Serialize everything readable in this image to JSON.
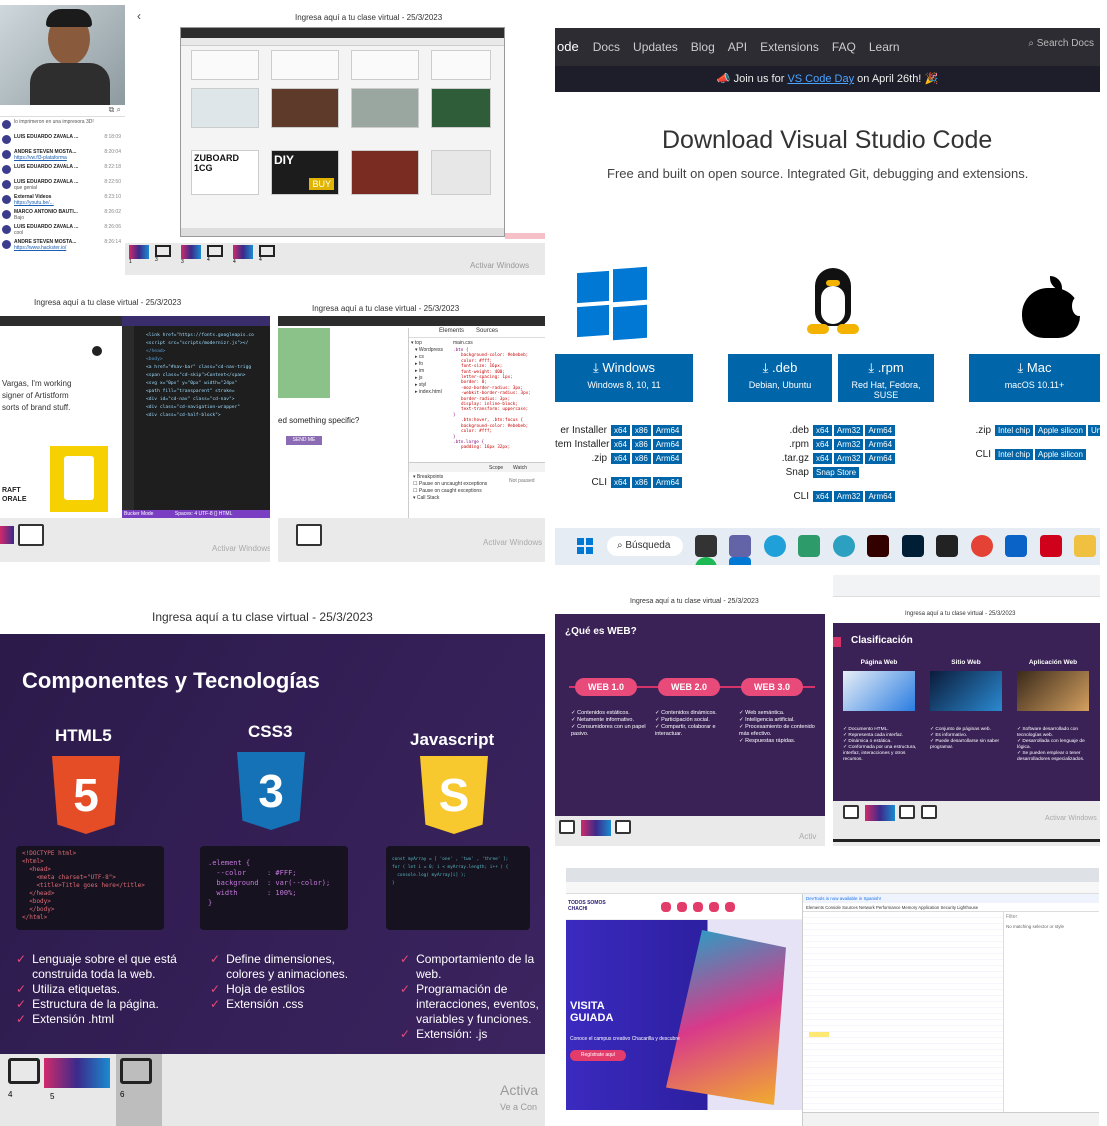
{
  "tile1": {
    "header": "Ingresa aquí a tu clase virtual - 25/3/2023",
    "back_arrow": "‹",
    "chat": [
      {
        "name": "",
        "msg": "lo imprimeron en una impresora 3D!",
        "time": ""
      },
      {
        "name": "LUIS EDUARDO ZAVALA ...",
        "msg": "",
        "time": "8:18:09"
      },
      {
        "name": "ANDRE STEVEN MOSTA...",
        "msg": "https://vw.fl3-plataforma",
        "time": "8:20:04"
      },
      {
        "name": "LUIS EDUARDO ZAVALA ...",
        "msg": "",
        "time": "8:22:18"
      },
      {
        "name": "LUIS EDUARDO ZAVALA ...",
        "msg": "que genial",
        "time": "8:22:50"
      },
      {
        "name": "External Videos",
        "msg": "https://youtu.be/...",
        "time": "8:23:10"
      },
      {
        "name": "MARCO ANTONIO BAUTI...",
        "msg": "Bajo",
        "time": "8:26:02"
      },
      {
        "name": "LUIS EDUARDO ZAVALA ...",
        "msg": "cool",
        "time": "8:26:06"
      },
      {
        "name": "ANDRE STEVEN MOSTA...",
        "msg": "https://www.hackster.io/",
        "time": "8:26:14"
      }
    ],
    "thumb_nums": [
      "1",
      "3",
      "3",
      "4",
      "4",
      "4"
    ],
    "watermark": "Activar Windows",
    "watermark2": "Ve a Configuración para activar Windows.",
    "products": [
      "ZUBOARD 1CG",
      "DIY",
      "BUY"
    ]
  },
  "tile2": {
    "nav": [
      "ode",
      "Docs",
      "Updates",
      "Blog",
      "API",
      "Extensions",
      "FAQ",
      "Learn"
    ],
    "search": "Search Docs",
    "banner_pre": "Join us for ",
    "banner_link": "VS Code Day",
    "banner_post": " on April 26th!",
    "title": "Download Visual Studio Code",
    "subtitle": "Free and built on open source. Integrated Git, debugging and extensions.",
    "windows": {
      "label": "Windows",
      "sub": "Windows 8, 10, 11"
    },
    "deb": {
      "label": ".deb",
      "sub": "Debian, Ubuntu"
    },
    "rpm": {
      "label": ".rpm",
      "sub": "Red Hat, Fedora, SUSE"
    },
    "mac": {
      "label": "Mac",
      "sub": "macOS 10.11+"
    },
    "win_rows": [
      [
        "er Installer",
        "x64",
        "x86",
        "Arm64"
      ],
      [
        "tem Installer",
        "x64",
        "x86",
        "Arm64"
      ],
      [
        ".zip",
        "x64",
        "x86",
        "Arm64"
      ],
      [
        "CLI",
        "x64",
        "x86",
        "Arm64"
      ]
    ],
    "lin_rows": [
      [
        ".deb",
        "x64",
        "Arm32",
        "Arm64"
      ],
      [
        ".rpm",
        "x64",
        "Arm32",
        "Arm64"
      ],
      [
        ".tar.gz",
        "x64",
        "Arm32",
        "Arm64"
      ],
      [
        "Snap",
        "Snap Store",
        "",
        ""
      ],
      [
        "CLI",
        "x64",
        "Arm32",
        "Arm64"
      ]
    ],
    "mac_rows": [
      [
        ".zip",
        "Intel chip",
        "Apple silicon",
        "Un"
      ],
      [
        "CLI",
        "Intel chip",
        "Apple silicon",
        ""
      ]
    ],
    "taskbar_search": "Búsqueda"
  },
  "tile3": {
    "header": "Ingresa aquí a tu clase virtual - 25/3/2023",
    "left_text": [
      "Vargas, I'm working",
      "signer of Artistform",
      "sorts of brand stuff."
    ],
    "brand": [
      "RAFT",
      "ORALE"
    ],
    "code": [
      "<link href=\"https://fonts.googleapis.co",
      "<script src=\"scripts/modernizr.js\"></",
      "</head>",
      "<body>",
      "<a href=\"#nav-bar\" class=\"cd-nav-trigg",
      "<span class=\"cd-skip\">Content</span>",
      "<svg x=\"0px\" y=\"0px\" width=\"24px\"",
      "<path fill=\"transparent\" stroke=",
      "<div id=\"cd-nav\" class=\"cd-nav\">",
      "<div class=\"cd-navigation-wrapper\"",
      "<div class=\"cd-half-block\">"
    ],
    "status": "Bucker Mode",
    "status2": "Spaces: 4  UTF-8  {} HTML",
    "watermark": "Activar Windows"
  },
  "tile4": {
    "header": "Ingresa aquí a tu clase virtual - 25/3/2023",
    "ask": "ed something specific?",
    "btn": "SEND ME",
    "tabs": [
      "Elements",
      "Sources"
    ],
    "file": "main.css",
    "css": [
      ".btn {",
      "background-color: #ebebeb;",
      "color: #fff;",
      "font-size: 16px;",
      "font-weight: 400;",
      "letter-spacing: 1px;",
      "border: 0;",
      "-moz-border-radius: 3px;",
      "-webkit-border-radius: 3px;",
      "border-radius: 3px;",
      "display: inline-block;",
      "text-transform: uppercase;",
      "}",
      ".btn:hover, .btn:focus {",
      "background-color: #ebebeb;",
      "color: #fff;",
      "}",
      ".btn.large {",
      "padding: 16px 32px;"
    ],
    "tree": [
      "top",
      "Wordpress",
      "cs",
      "fo",
      "im",
      "js",
      "styl",
      "index.html"
    ],
    "bp": [
      "Breakpoints",
      "Pause on uncaught exceptions",
      "Pause on caught exceptions",
      "Call Stack"
    ],
    "scope": "Scope",
    "watch": "Watch",
    "not_paused": "Not paused",
    "watermark": "Activar Windows"
  },
  "tile5": {
    "header": "Ingresa aquí a tu clase virtual - 25/3/2023",
    "title": "Componentes y Tecnologías",
    "cols": [
      {
        "name": "HTML5",
        "glyph": "5",
        "bullets": [
          "Lenguaje sobre el que está construida toda la web.",
          "Utiliza etiquetas.",
          "Estructura de la página.",
          "Extensión .html"
        ]
      },
      {
        "name": "CSS3",
        "glyph": "3",
        "bullets": [
          "Define dimensiones, colores y animaciones.",
          "Hoja de estilos",
          "Extensión .css"
        ]
      },
      {
        "name": "Javascript",
        "glyph": "S",
        "bullets": [
          "Comportamiento de la web.",
          "Programación de interacciones, eventos, variables y funciones.",
          "Extensión: .js"
        ]
      }
    ],
    "html_code": [
      "<!DOCTYPE html>",
      "<html>",
      "  <head>",
      "    <meta charset=\"UTF-8\">",
      "    <title>Title goes here</title>",
      "  </head>",
      "  <body>",
      "",
      "  </body>",
      "</html>"
    ],
    "css_code": [
      ".element {",
      "  --color     : #FFF;",
      "  background  : var(--color);",
      "  width       : 100%;",
      "}"
    ],
    "js_code": [
      "const myArray = [ 'one' , 'two' , 'three' ];",
      "",
      "for ( let i = 0; i < myArray.length; i++ ) {",
      "  console.log( myArray[i] );",
      "}"
    ],
    "thumb_nums": [
      "4",
      "5",
      "6"
    ],
    "watermark": "Activa",
    "watermark2": "Ve a Con"
  },
  "tile6": {
    "header": "Ingresa aquí a tu clase virtual - 25/3/2023",
    "title": "¿Qué es WEB?",
    "pills": [
      "WEB 1.0",
      "WEB 2.0",
      "WEB 3.0"
    ],
    "cols": [
      [
        "Contenidos estáticos.",
        "Netamente informativo.",
        "Consumidores con un papel pasivo."
      ],
      [
        "Contenidos dinámicos.",
        "Participación social.",
        "Compartir, colaborar e interactuar."
      ],
      [
        "Web semántica.",
        "Inteligencia artificial.",
        "Procesamiento de contenido más efectivo.",
        "Respuestas rápidas."
      ]
    ],
    "watermark": "Activ"
  },
  "tile7": {
    "header": "Ingresa aquí a tu clase virtual - 25/3/2023",
    "title": "Clasificación",
    "cols": [
      {
        "name": "Página Web",
        "bullets": [
          "Documento HTML.",
          "Representa cada interfaz.",
          "Dinámica o estática.",
          "Conformada por una estructura, interfaz, interacciones y otros recursos."
        ]
      },
      {
        "name": "Sitio Web",
        "bullets": [
          "Conjunto de páginas web.",
          "Es informativo.",
          "Puede desarrollarse sin saber programar."
        ]
      },
      {
        "name": "Aplicación Web",
        "bullets": [
          "Software desarrollado con tecnologías web.",
          "Desarrollada con lenguaje de lógica.",
          "Se pueden emplear o tener desarrolladores especializados."
        ]
      }
    ],
    "watermark": "Activar Windows"
  },
  "tile8": {
    "site_name": "TODOS SOMOS CHACHI",
    "headline": "VISITA GUIADA",
    "tag": "Conoce el campus creativo Chacarilla y descubre",
    "btn": "Regístrate aquí",
    "devtools_banner": "Elements Console Sources Network Performance Memory Application Security Lighthouse",
    "note": "DevTools is now available in Spanish!",
    "filter": "Filter",
    "nothing": "No matching selector or style"
  }
}
